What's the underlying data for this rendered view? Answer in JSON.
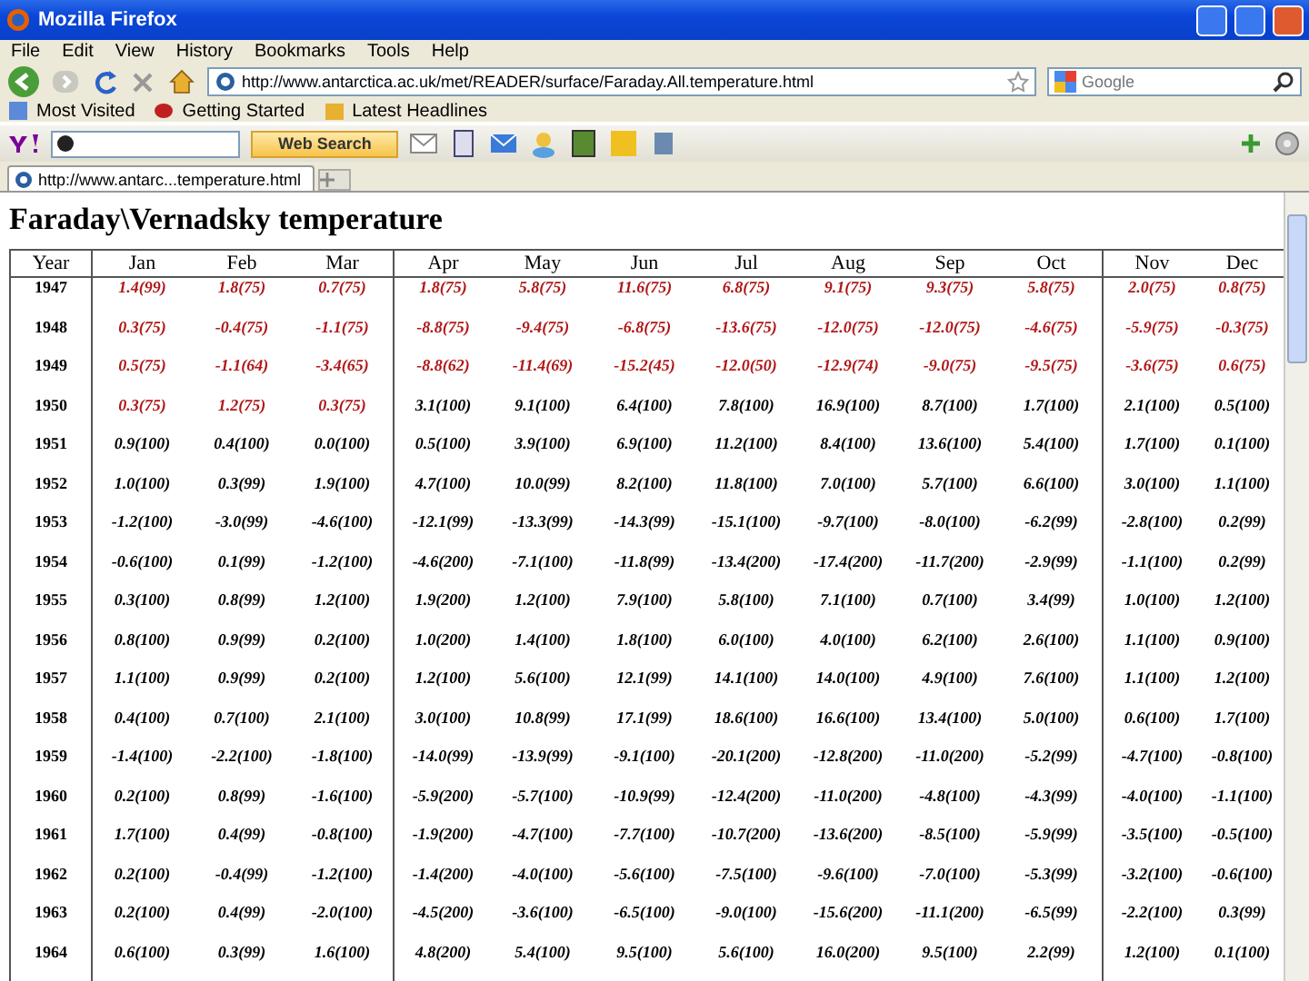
{
  "window": {
    "title": "Mozilla Firefox"
  },
  "menu": [
    "File",
    "Edit",
    "View",
    "History",
    "Bookmarks",
    "Tools",
    "Help"
  ],
  "address": {
    "value": "http://www.antarctica.ac.uk/met/READER/surface/Faraday.All.temperature.html"
  },
  "search": {
    "placeholder": "Google"
  },
  "bookmarks": [
    "Most Visited",
    "Getting Started",
    "Latest Headlines"
  ],
  "yahoo_toolbar": {
    "search_button": "Web Search"
  },
  "tabs": [
    {
      "label": "http://www.antarc...temperature.html",
      "selected": true
    }
  ],
  "page": {
    "heading": "Faraday\\Vernadsky temperature",
    "table": {
      "columns": [
        "Year",
        "Jan",
        "Feb",
        "Mar",
        "Apr",
        "May",
        "Jun",
        "Jul",
        "Aug",
        "Sep",
        "Oct",
        "Nov",
        "Dec"
      ],
      "rows": [
        [
          "1947",
          {
            "v": "1.4(99)",
            "color": "#b01818"
          },
          {
            "v": "1.8(75)",
            "color": "#b01818"
          },
          {
            "v": "0.7(75)",
            "color": "#b01818"
          },
          {
            "v": "1.8(75)",
            "color": "#b01818"
          },
          {
            "v": "5.8(75)",
            "color": "#b01818"
          },
          {
            "v": "11.6(75)",
            "color": "#b01818"
          },
          {
            "v": "6.8(75)",
            "color": "#b01818"
          },
          {
            "v": "9.1(75)",
            "color": "#b01818"
          },
          {
            "v": "9.3(75)",
            "color": "#b01818"
          },
          {
            "v": "5.8(75)",
            "color": "#b01818"
          },
          {
            "v": "2.0(75)",
            "color": "#b01818"
          },
          {
            "v": "0.8(75)",
            "color": "#b01818"
          }
        ],
        [
          "1948",
          {
            "v": "0.3(75)",
            "color": "#b01818"
          },
          {
            "v": "-0.4(75)",
            "color": "#b01818"
          },
          {
            "v": "-1.1(75)",
            "color": "#b01818"
          },
          {
            "v": "-8.8(75)",
            "color": "#b01818"
          },
          {
            "v": "-9.4(75)",
            "color": "#b01818"
          },
          {
            "v": "-6.8(75)",
            "color": "#b01818"
          },
          {
            "v": "-13.6(75)",
            "color": "#b01818"
          },
          {
            "v": "-12.0(75)",
            "color": "#b01818"
          },
          {
            "v": "-12.0(75)",
            "color": "#b01818"
          },
          {
            "v": "-4.6(75)",
            "color": "#b01818"
          },
          {
            "v": "-5.9(75)",
            "color": "#b01818"
          },
          {
            "v": "-0.3(75)",
            "color": "#b01818"
          }
        ],
        [
          "1949",
          {
            "v": "0.5(75)",
            "color": "#b01818"
          },
          {
            "v": "-1.1(64)",
            "color": "#b01818"
          },
          {
            "v": "-3.4(65)",
            "color": "#b01818"
          },
          {
            "v": "-8.8(62)",
            "color": "#b01818"
          },
          {
            "v": "-11.4(69)",
            "color": "#b01818"
          },
          {
            "v": "-15.2(45)",
            "color": "#b01818"
          },
          {
            "v": "-12.0(50)",
            "color": "#b01818"
          },
          {
            "v": "-12.9(74)",
            "color": "#b01818"
          },
          {
            "v": "-9.0(75)",
            "color": "#b01818"
          },
          {
            "v": "-9.5(75)",
            "color": "#b01818"
          },
          {
            "v": "-3.6(75)",
            "color": "#b01818"
          },
          {
            "v": "0.6(75)",
            "color": "#b01818"
          }
        ],
        [
          "1950",
          {
            "v": "0.3(75)",
            "color": "#b01818"
          },
          {
            "v": "1.2(75)",
            "color": "#b01818"
          },
          {
            "v": "0.3(75)",
            "color": "#b01818"
          },
          "3.1(100)",
          "9.1(100)",
          "6.4(100)",
          "7.8(100)",
          "16.9(100)",
          "8.7(100)",
          "1.7(100)",
          "2.1(100)",
          "0.5(100)"
        ],
        [
          "1951",
          "0.9(100)",
          "0.4(100)",
          "0.0(100)",
          "0.5(100)",
          "3.9(100)",
          "6.9(100)",
          "11.2(100)",
          "8.4(100)",
          "13.6(100)",
          "5.4(100)",
          "1.7(100)",
          "0.1(100)"
        ],
        [
          "1952",
          "1.0(100)",
          "0.3(99)",
          "1.9(100)",
          "4.7(100)",
          "10.0(99)",
          "8.2(100)",
          "11.8(100)",
          "7.0(100)",
          "5.7(100)",
          "6.6(100)",
          "3.0(100)",
          "1.1(100)"
        ],
        [
          "1953",
          "-1.2(100)",
          "-3.0(99)",
          "-4.6(100)",
          "-12.1(99)",
          "-13.3(99)",
          "-14.3(99)",
          "-15.1(100)",
          "-9.7(100)",
          "-8.0(100)",
          "-6.2(99)",
          "-2.8(100)",
          "0.2(99)"
        ],
        [
          "1954",
          "-0.6(100)",
          "0.1(99)",
          "-1.2(100)",
          "-4.6(200)",
          "-7.1(100)",
          "-11.8(99)",
          "-13.4(200)",
          "-17.4(200)",
          "-11.7(200)",
          "-2.9(99)",
          "-1.1(100)",
          "0.2(99)"
        ],
        [
          "1955",
          "0.3(100)",
          "0.8(99)",
          "1.2(100)",
          "1.9(200)",
          "1.2(100)",
          "7.9(100)",
          "5.8(100)",
          "7.1(100)",
          "0.7(100)",
          "3.4(99)",
          "1.0(100)",
          "1.2(100)"
        ],
        [
          "1956",
          "0.8(100)",
          "0.9(99)",
          "0.2(100)",
          "1.0(200)",
          "1.4(100)",
          "1.8(100)",
          "6.0(100)",
          "4.0(100)",
          "6.2(100)",
          "2.6(100)",
          "1.1(100)",
          "0.9(100)"
        ],
        [
          "1957",
          "1.1(100)",
          "0.9(99)",
          "0.2(100)",
          "1.2(100)",
          "5.6(100)",
          "12.1(99)",
          "14.1(100)",
          "14.0(100)",
          "4.9(100)",
          "7.6(100)",
          "1.1(100)",
          "1.2(100)"
        ],
        [
          "1958",
          "0.4(100)",
          "0.7(100)",
          "2.1(100)",
          "3.0(100)",
          "10.8(99)",
          "17.1(99)",
          "18.6(100)",
          "16.6(100)",
          "13.4(100)",
          "5.0(100)",
          "0.6(100)",
          "1.7(100)"
        ],
        [
          "1959",
          "-1.4(100)",
          "-2.2(100)",
          "-1.8(100)",
          "-14.0(99)",
          "-13.9(99)",
          "-9.1(100)",
          "-20.1(200)",
          "-12.8(200)",
          "-11.0(200)",
          "-5.2(99)",
          "-4.7(100)",
          "-0.8(100)"
        ],
        [
          "1960",
          "0.2(100)",
          "0.8(99)",
          "-1.6(100)",
          "-5.9(200)",
          "-5.7(100)",
          "-10.9(99)",
          "-12.4(200)",
          "-11.0(200)",
          "-4.8(100)",
          "-4.3(99)",
          "-4.0(100)",
          "-1.1(100)"
        ],
        [
          "1961",
          "1.7(100)",
          "0.4(99)",
          "-0.8(100)",
          "-1.9(200)",
          "-4.7(100)",
          "-7.7(100)",
          "-10.7(200)",
          "-13.6(200)",
          "-8.5(100)",
          "-5.9(99)",
          "-3.5(100)",
          "-0.5(100)"
        ],
        [
          "1962",
          "0.2(100)",
          "-0.4(99)",
          "-1.2(100)",
          "-1.4(200)",
          "-4.0(100)",
          "-5.6(100)",
          "-7.5(100)",
          "-9.6(100)",
          "-7.0(100)",
          "-5.3(99)",
          "-3.2(100)",
          "-0.6(100)"
        ],
        [
          "1963",
          "0.2(100)",
          "0.4(99)",
          "-2.0(100)",
          "-4.5(200)",
          "-3.6(100)",
          "-6.5(100)",
          "-9.0(100)",
          "-15.6(200)",
          "-11.1(200)",
          "-6.5(99)",
          "-2.2(100)",
          "0.3(99)"
        ],
        [
          "1964",
          "0.6(100)",
          "0.3(99)",
          "1.6(100)",
          "4.8(200)",
          "5.4(100)",
          "9.5(100)",
          "5.6(100)",
          "16.0(200)",
          "9.5(100)",
          "2.2(99)",
          "1.2(100)",
          "0.1(100)"
        ]
      ]
    }
  }
}
